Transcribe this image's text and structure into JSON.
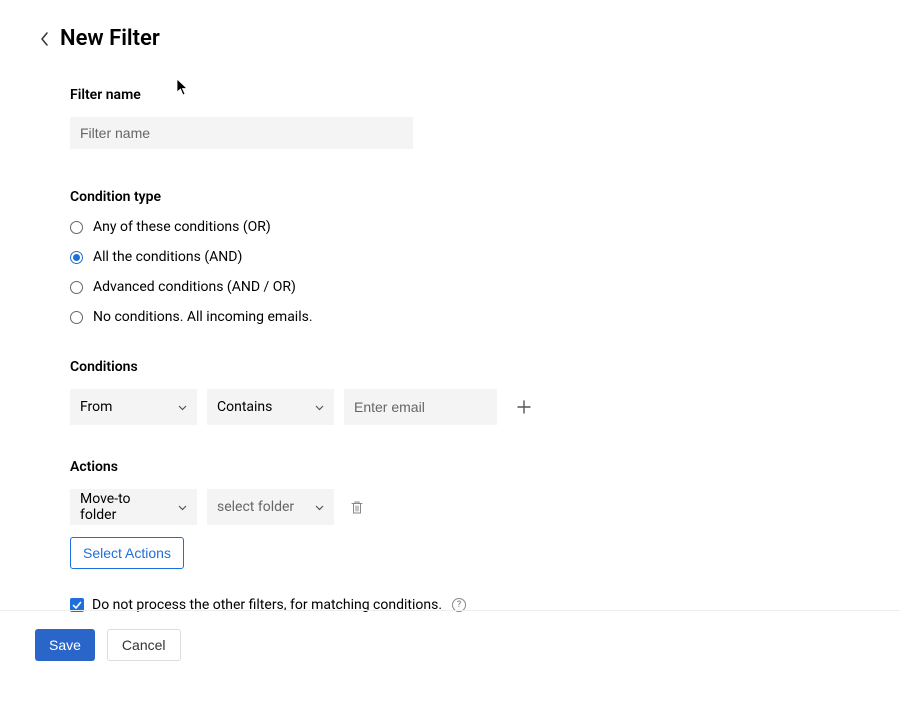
{
  "header": {
    "title": "New Filter"
  },
  "filterName": {
    "label": "Filter name",
    "placeholder": "Filter name",
    "value": ""
  },
  "conditionType": {
    "label": "Condition type",
    "options": [
      {
        "label": "Any of these conditions (OR)",
        "selected": false
      },
      {
        "label": "All the conditions (AND)",
        "selected": true
      },
      {
        "label": "Advanced conditions (AND / OR)",
        "selected": false
      },
      {
        "label": "No conditions. All incoming emails.",
        "selected": false
      }
    ]
  },
  "conditions": {
    "label": "Conditions",
    "row": {
      "field": "From",
      "operator": "Contains",
      "valuePlaceholder": "Enter email"
    }
  },
  "actions": {
    "label": "Actions",
    "row": {
      "action": "Move-to folder",
      "targetPlaceholder": "select folder"
    },
    "selectActionsLabel": "Select Actions"
  },
  "stopProcessing": {
    "label": "Do not process the other filters, for matching conditions.",
    "checked": true,
    "helpGlyph": "?"
  },
  "footer": {
    "save": "Save",
    "cancel": "Cancel"
  }
}
